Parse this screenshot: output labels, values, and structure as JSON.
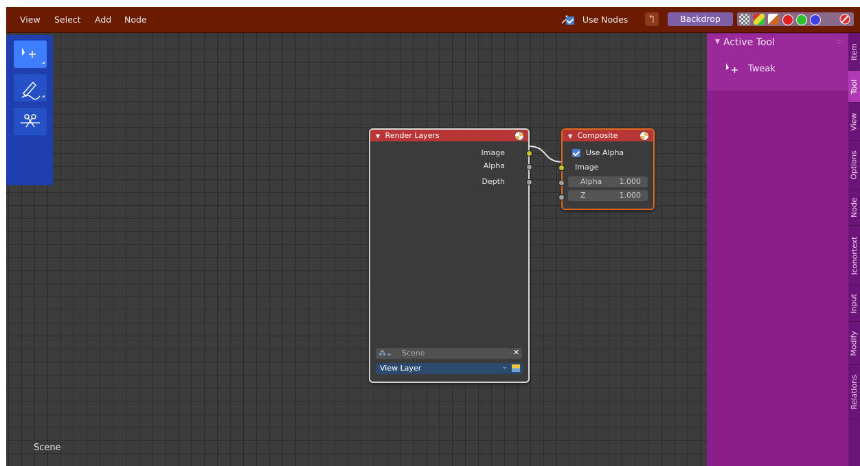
{
  "header": {
    "menu": [
      "View",
      "Select",
      "Add",
      "Node"
    ],
    "use_nodes_label": "Use Nodes",
    "backdrop_label": "Backdrop"
  },
  "toolbar": {
    "tools": [
      "tweak-tool",
      "annotate-tool",
      "cut-links-tool"
    ]
  },
  "canvas": {
    "scene_label": "Scene"
  },
  "nodes": {
    "render_layers": {
      "title": "Render Layers",
      "outputs": [
        "Image",
        "Alpha",
        "Depth"
      ],
      "scene_value": "Scene",
      "view_layer_value": "View Layer"
    },
    "composite": {
      "title": "Composite",
      "use_alpha_label": "Use Alpha",
      "inputs": [
        {
          "label": "Image"
        },
        {
          "label": "Alpha",
          "value": "1.000"
        },
        {
          "label": "Z",
          "value": "1.000"
        }
      ]
    }
  },
  "sidebar": {
    "panel_title": "Active Tool",
    "tool_name": "Tweak",
    "tabs": [
      "Item",
      "Tool",
      "View",
      "Options",
      "Node",
      "Iconortext",
      "Input",
      "Modify",
      "Relations"
    ],
    "active_tab": "Tool"
  },
  "colors": {
    "header_bg": "#6b1b00",
    "sidebar_bg": "#8a1f8a",
    "toolbar_bg": "#1f3fae",
    "render_layers_header": "#b83636",
    "composite_header": "#b83636",
    "socket_color_image": "#c7c729",
    "socket_color_value": "#a1a1a1"
  }
}
